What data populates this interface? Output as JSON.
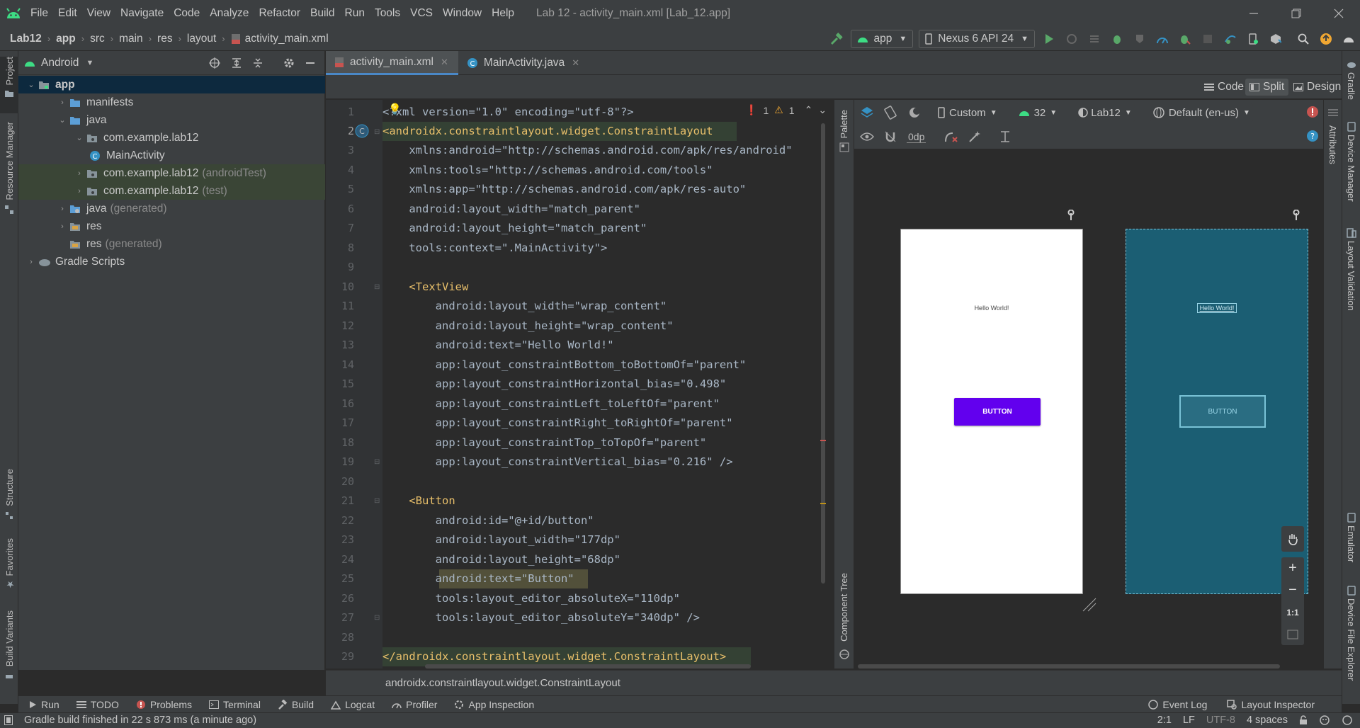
{
  "menu": [
    "File",
    "Edit",
    "View",
    "Navigate",
    "Code",
    "Analyze",
    "Refactor",
    "Build",
    "Run",
    "Tools",
    "VCS",
    "Window",
    "Help"
  ],
  "window_title": "Lab 12 - activity_main.xml [Lab_12.app]",
  "breadcrumbs": [
    "Lab12",
    "app",
    "src",
    "main",
    "res",
    "layout",
    "activity_main.xml"
  ],
  "toolbar": {
    "run_config": "app",
    "device": "Nexus 6 API 24"
  },
  "project": {
    "view_label": "Android",
    "tree": [
      {
        "label": "app",
        "extra": ""
      },
      {
        "label": "manifests",
        "extra": ""
      },
      {
        "label": "java",
        "extra": ""
      },
      {
        "label": "com.example.lab12",
        "extra": ""
      },
      {
        "label": "MainActivity",
        "extra": ""
      },
      {
        "label": "com.example.lab12",
        "extra": "(androidTest)"
      },
      {
        "label": "com.example.lab12",
        "extra": "(test)"
      },
      {
        "label": "java",
        "extra": "(generated)"
      },
      {
        "label": "res",
        "extra": ""
      },
      {
        "label": "res",
        "extra": "(generated)"
      },
      {
        "label": "Gradle Scripts",
        "extra": ""
      }
    ]
  },
  "left_tools": {
    "project": "Project",
    "resource_manager": "Resource Manager",
    "structure": "Structure",
    "favorites": "Favorites",
    "build_variants": "Build Variants"
  },
  "right_tools": {
    "gradle": "Gradle",
    "device_manager": "Device Manager",
    "layout_validation": "Layout Validation",
    "emulator": "Emulator",
    "device_file_explorer": "Device File Explorer"
  },
  "editor_tabs": [
    {
      "label": "activity_main.xml"
    },
    {
      "label": "MainActivity.java"
    }
  ],
  "modes": {
    "code": "Code",
    "split": "Split",
    "design": "Design"
  },
  "inspections": {
    "errors": "1",
    "warnings": "1"
  },
  "line_numbers": [
    "1",
    "2",
    "3",
    "4",
    "5",
    "6",
    "7",
    "8",
    "9",
    "10",
    "11",
    "12",
    "13",
    "14",
    "15",
    "16",
    "17",
    "18",
    "19",
    "20",
    "21",
    "22",
    "23",
    "24",
    "25",
    "26",
    "27",
    "28",
    "29"
  ],
  "code_lines": [
    "<?xml version=\"1.0\" encoding=\"utf-8\"?>",
    "<androidx.constraintlayout.widget.ConstraintLayout",
    "    xmlns:android=\"http://schemas.android.com/apk/res/android\"",
    "    xmlns:tools=\"http://schemas.android.com/tools\"",
    "    xmlns:app=\"http://schemas.android.com/apk/res-auto\"",
    "    android:layout_width=\"match_parent\"",
    "    android:layout_height=\"match_parent\"",
    "    tools:context=\".MainActivity\">",
    "",
    "    <TextView",
    "        android:layout_width=\"wrap_content\"",
    "        android:layout_height=\"wrap_content\"",
    "        android:text=\"Hello World!\"",
    "        app:layout_constraintBottom_toBottomOf=\"parent\"",
    "        app:layout_constraintHorizontal_bias=\"0.498\"",
    "        app:layout_constraintLeft_toLeftOf=\"parent\"",
    "        app:layout_constraintRight_toRightOf=\"parent\"",
    "        app:layout_constraintTop_toTopOf=\"parent\"",
    "        app:layout_constraintVertical_bias=\"0.216\" />",
    "",
    "    <Button",
    "        android:id=\"@+id/button\"",
    "        android:layout_width=\"177dp\"",
    "        android:layout_height=\"68dp\"",
    "        android:text=\"Button\"",
    "        tools:layout_editor_absoluteX=\"110dp\"",
    "        tools:layout_editor_absoluteY=\"340dp\" />",
    "",
    "</androidx.constraintlayout.widget.ConstraintLayout>"
  ],
  "design_toolbar": {
    "device": "Custom",
    "api": "32",
    "theme": "Lab12",
    "locale": "Default (en-us)",
    "margin": "0dp"
  },
  "side_labels": {
    "palette": "Palette",
    "attributes": "Attributes",
    "component_tree": "Component Tree"
  },
  "preview": {
    "text": "Hello World!",
    "button": "BUTTON"
  },
  "zoom_labels": {
    "fit": "1:1"
  },
  "bottom_breadcrumb": "androidx.constraintlayout.widget.ConstraintLayout",
  "bottom_tabs": [
    "Run",
    "TODO",
    "Problems",
    "Terminal",
    "Build",
    "Logcat",
    "Profiler",
    "App Inspection"
  ],
  "bottom_right_tabs": [
    "Event Log",
    "Layout Inspector"
  ],
  "status": {
    "message": "Gradle build finished in 22 s 873 ms (a minute ago)",
    "position": "2:1",
    "line_sep": "LF",
    "encoding": "UTF-8",
    "indent": "4 spaces"
  },
  "colors": {
    "accent": "#4a88c7",
    "button_purple": "#6200ee",
    "blueprint": "#1b5e73",
    "android_green": "#3ddc84"
  }
}
